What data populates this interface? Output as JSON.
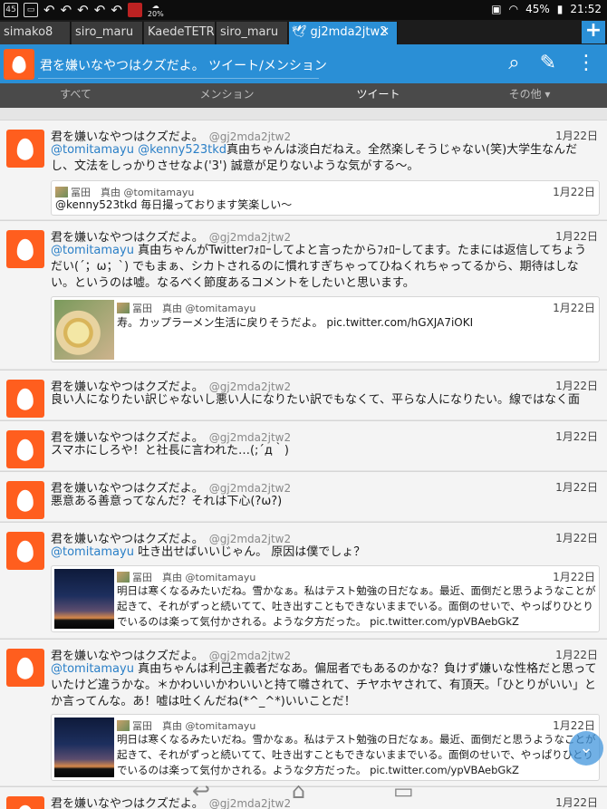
{
  "status": {
    "notif_count": "45",
    "battery": "45%",
    "time": "21:52",
    "battery_small": "20%"
  },
  "tabs": [
    {
      "label": "simako8"
    },
    {
      "label": "siro_maru"
    },
    {
      "label": "KaedeTETR..."
    },
    {
      "label": "siro_maru"
    },
    {
      "label": "gj2mda2jtw2"
    }
  ],
  "tab_add_label": "+",
  "header": {
    "title": "君を嫌いなやつはクズだよ。 ツイート/メンション"
  },
  "filters": [
    {
      "label": "すべて"
    },
    {
      "label": "メンション"
    },
    {
      "label": "ツイート"
    },
    {
      "label": "その他 ▾"
    }
  ],
  "tweets": [
    {
      "name": "君を嫌いなやつはクズだよ。",
      "screen_name": "@gj2mda2jtw2",
      "date": "1月22日",
      "mention": "@tomitamayu @kenny523tkd",
      "text": "真由ちゃんは淡白だねえ。全然楽しそうじゃない(笑)大学生なんだし、文法をしっかりさせなよ('3') 誠意が足りないような気がする～。",
      "quote": {
        "name": "冨田　真由",
        "screen_name": "@tomitamayu",
        "date": "1月22日",
        "text": "@kenny523tkd 毎日撮っております笑楽しい〜"
      }
    },
    {
      "name": "君を嫌いなやつはクズだよ。",
      "screen_name": "@gj2mda2jtw2",
      "date": "1月22日",
      "mention": "@tomitamayu",
      "text": "真由ちゃんがTwitterﾌｫﾛｰしてよと言ったからﾌｫﾛｰしてます。たまには返信してちょうだい(´；ω；`) でもまぁ、シカトされるのに慣れすぎちゃってひねくれちゃってるから、期待はしない。というのは嘘。なるべく節度あるコメントをしたいと思います。",
      "quote": {
        "name": "冨田　真由",
        "screen_name": "@tomitamayu",
        "date": "1月22日",
        "text": "寿。カップラーメン生活に戻りそうだよ。 pic.twitter.com/hGXJA7iOKI"
      }
    },
    {
      "name": "君を嫌いなやつはクズだよ。",
      "screen_name": "@gj2mda2jtw2",
      "date": "1月22日",
      "text": "良い人になりたい訳じゃないし悪い人になりたい訳でもなくて、平らな人になりたい。線ではなく面"
    },
    {
      "name": "君を嫌いなやつはクズだよ。",
      "screen_name": "@gj2mda2jtw2",
      "date": "1月22日",
      "text": "スマホにしろや！と社長に言われた…(;´д｀)"
    },
    {
      "name": "君を嫌いなやつはクズだよ。",
      "screen_name": "@gj2mda2jtw2",
      "date": "1月22日",
      "text": "悪意ある善意ってなんだ？それは下心(?ω?)"
    },
    {
      "name": "君を嫌いなやつはクズだよ。",
      "screen_name": "@gj2mda2jtw2",
      "date": "1月22日",
      "mention": "@tomitamayu",
      "text": "吐き出せばいいじゃん。 原因は僕でしょ？",
      "quote": {
        "name": "冨田　真由",
        "screen_name": "@tomitamayu",
        "date": "1月22日",
        "text": "明日は寒くなるみたいだね。雪かなぁ。私はテスト勉強の日だなぁ。最近、面倒だと思うようなことが起きて、それがずっと続いてて、吐き出すこともできないままでいる。面倒のせいで、やっぱりひとりでいるのは楽って気付かされる。ような夕方だった。 pic.twitter.com/ypVBAebGkZ"
      }
    },
    {
      "name": "君を嫌いなやつはクズだよ。",
      "screen_name": "@gj2mda2jtw2",
      "date": "1月22日",
      "mention": "@tomitamayu",
      "text": "真由ちゃんは利己主義者だなあ。偏屈者でもあるのかな？負けず嫌いな性格だと思っていたけど違うかな。＊かわいいかわいいと持て囃されて、チヤホヤされて、有頂天。「ひとりがいい」とか言ってんな。あ！嘘は吐くんだね(*^_^*)いいことだ！",
      "quote": {
        "name": "冨田　真由",
        "screen_name": "@tomitamayu",
        "date": "1月22日",
        "text": "明日は寒くなるみたいだね。雪かなぁ。私はテスト勉強の日だなぁ。最近、面倒だと思うようなことが起きて、それがずっと続いてて、吐き出すこともできないままでいる。面倒のせいで、やっぱりひとりでいるのは楽って気付かされる。ような夕方だった。 pic.twitter.com/ypVBAebGkZ"
      }
    },
    {
      "name": "君を嫌いなやつはクズだよ。",
      "screen_name": "@gj2mda2jtw2",
      "date": "1月22日"
    }
  ],
  "colors": {
    "accent": "#2a8fd6",
    "avatar": "#ff5e1e",
    "mention": "#2a7fc7"
  }
}
